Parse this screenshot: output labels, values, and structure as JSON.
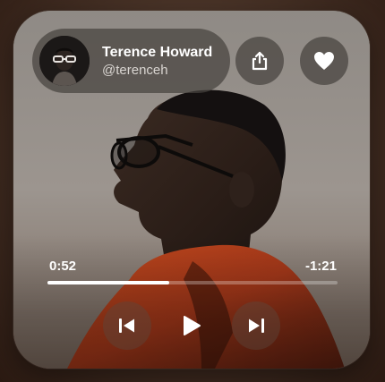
{
  "profile": {
    "name": "Terence Howard",
    "handle": "@terenceh",
    "avatar_icon": "person-with-glasses-avatar"
  },
  "actions": {
    "share_icon": "share-icon",
    "favorite_icon": "heart-icon"
  },
  "player": {
    "elapsed": "0:52",
    "remaining": "-1:21",
    "progress_fraction": 0.42,
    "controls": [
      "previous-track-icon",
      "play-icon",
      "next-track-icon"
    ]
  },
  "colors": {
    "control_fill": "#ffffff",
    "pill_background": "#46423f"
  }
}
